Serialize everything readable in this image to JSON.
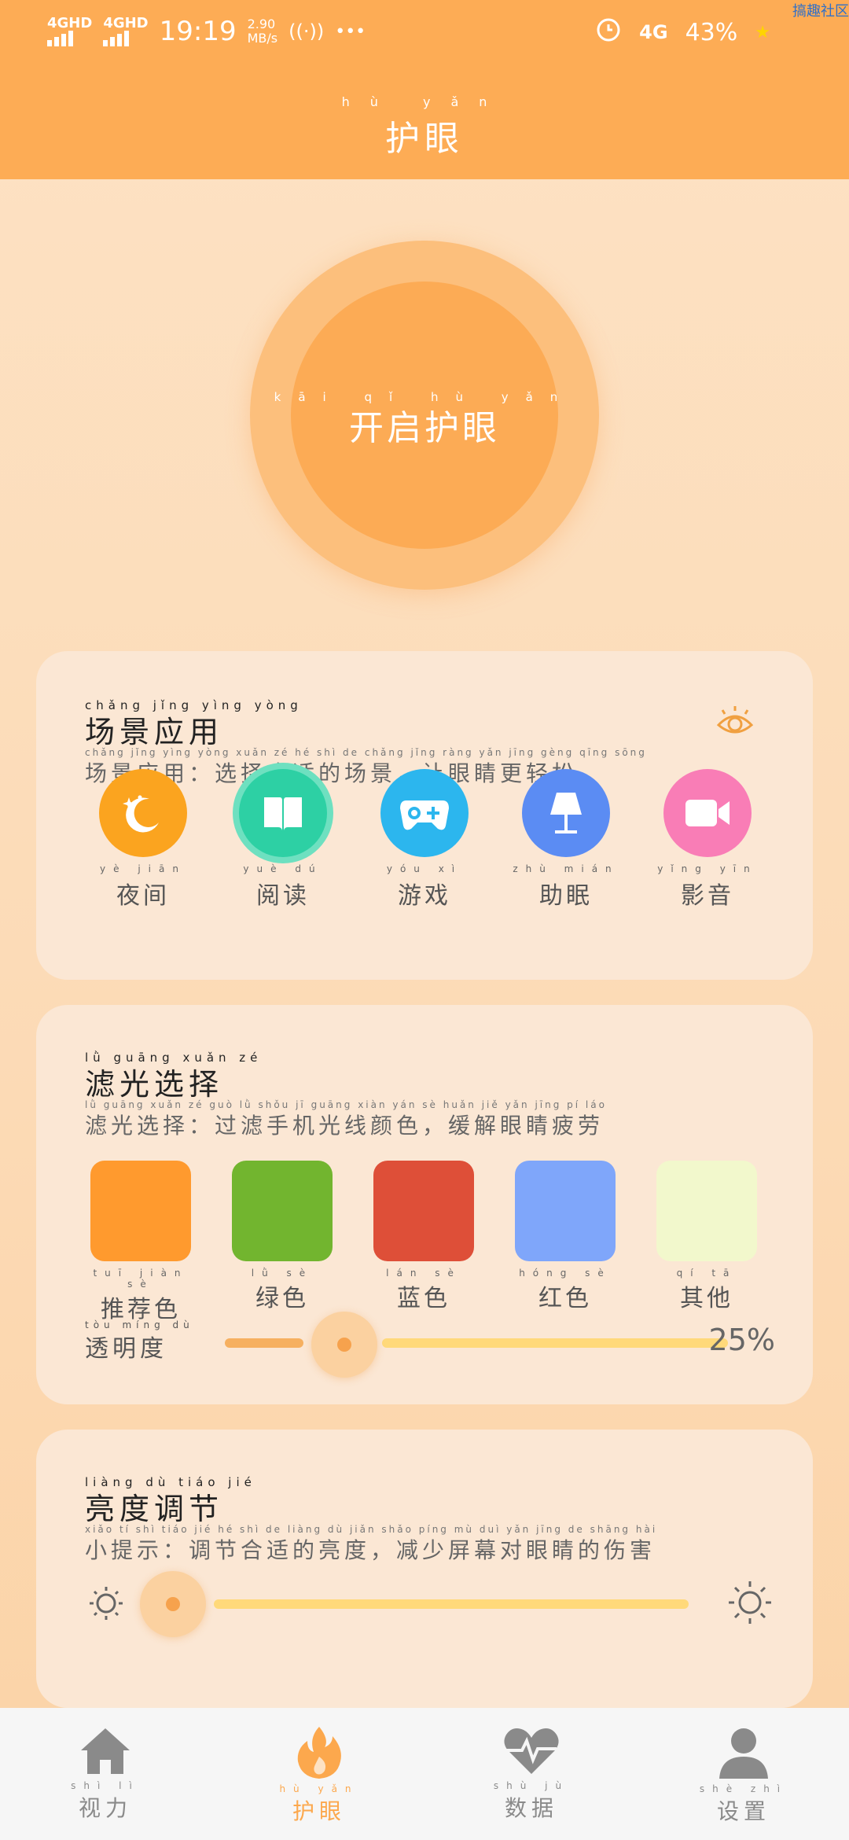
{
  "status_bar": {
    "signal1": "4GHD",
    "signal2": "4GHD",
    "time": "19:19",
    "speed_top": "2.90",
    "speed_bottom": "MB/s",
    "more": "•••",
    "network": "4G",
    "battery": "43%",
    "corner_tag": "搞趣社区"
  },
  "header": {
    "title": "护眼",
    "title_pinyin": "hù yǎn"
  },
  "main_button": {
    "label": "开启护眼",
    "pinyin": "kāi qǐ hù yǎn"
  },
  "scene_card": {
    "title": "场景应用",
    "title_pinyin": "chǎng jǐng yìng yòng",
    "subtitle": "场景应用：选择合适的场景，让眼睛更轻松",
    "subtitle_pinyin": "chǎng jǐng yìng yòng    xuǎn zé hé shì de chǎng jǐng   ràng yǎn jīng gèng qīng sōng",
    "items": [
      {
        "label": "夜间",
        "pinyin": "yè jiān",
        "icon": "moon-icon",
        "color": "#fba41f"
      },
      {
        "label": "阅读",
        "pinyin": "yuè dú",
        "icon": "book-icon",
        "color": "#2dd0a4"
      },
      {
        "label": "游戏",
        "pinyin": "yóu xì",
        "icon": "gamepad-icon",
        "color": "#2cb6ee"
      },
      {
        "label": "助眠",
        "pinyin": "zhù mián",
        "icon": "lamp-icon",
        "color": "#5b8cf3"
      },
      {
        "label": "影音",
        "pinyin": "yǐng yīn",
        "icon": "video-icon",
        "color": "#f97db6"
      }
    ]
  },
  "filter_card": {
    "title": "滤光选择",
    "title_pinyin": "lǜ guāng xuǎn zé",
    "subtitle": "滤光选择：过滤手机光线颜色，缓解眼睛疲劳",
    "subtitle_pinyin": "lǜ guāng xuǎn zé    guò lǜ shǒu jī guāng xiàn yán sè   huǎn jiě yǎn jīng pí láo",
    "swatches": [
      {
        "label": "推荐色",
        "pinyin": "tuī jiàn sè",
        "color": "#ff9a2e"
      },
      {
        "label": "绿色",
        "pinyin": "lǜ sè",
        "color": "#72b52f"
      },
      {
        "label": "蓝色",
        "pinyin": "lán sè",
        "color": "#de4f38"
      },
      {
        "label": "红色",
        "pinyin": "hóng sè",
        "color": "#7fa6fa"
      },
      {
        "label": "其他",
        "pinyin": "qí tā",
        "color": "#f2f8cc"
      }
    ],
    "opacity_label": "透明度",
    "opacity_pinyin": "tòu míng dù",
    "opacity_value": "25%",
    "opacity_fraction": 0.25
  },
  "brightness_card": {
    "title": "亮度调节",
    "title_pinyin": "liàng dù tiáo jié",
    "subtitle": "小提示：调节合适的亮度，减少屏幕对眼睛的伤害",
    "subtitle_pinyin": "xiǎo tí shì    tiáo jié hé shì de liàng dù   jiǎn shǎo píng mù duì yǎn jīng de shāng hài",
    "brightness_fraction": 0.0
  },
  "tabbar": {
    "tabs": [
      {
        "label": "视力",
        "pinyin": "shì lì",
        "icon": "house-icon"
      },
      {
        "label": "护眼",
        "pinyin": "hù yǎn",
        "icon": "flame-icon"
      },
      {
        "label": "数据",
        "pinyin": "shù jù",
        "icon": "heart-pulse-icon"
      },
      {
        "label": "设置",
        "pinyin": "shè zhì",
        "icon": "person-icon"
      }
    ],
    "active_index": 1
  },
  "colors": {
    "accent": "#fdac55",
    "accent_light": "#fcbf7c",
    "card_bg": "#fbe7d4",
    "slider_track": "#ffd97a",
    "tab_active": "#fca84d",
    "tab_inactive": "#8a8a8a"
  }
}
